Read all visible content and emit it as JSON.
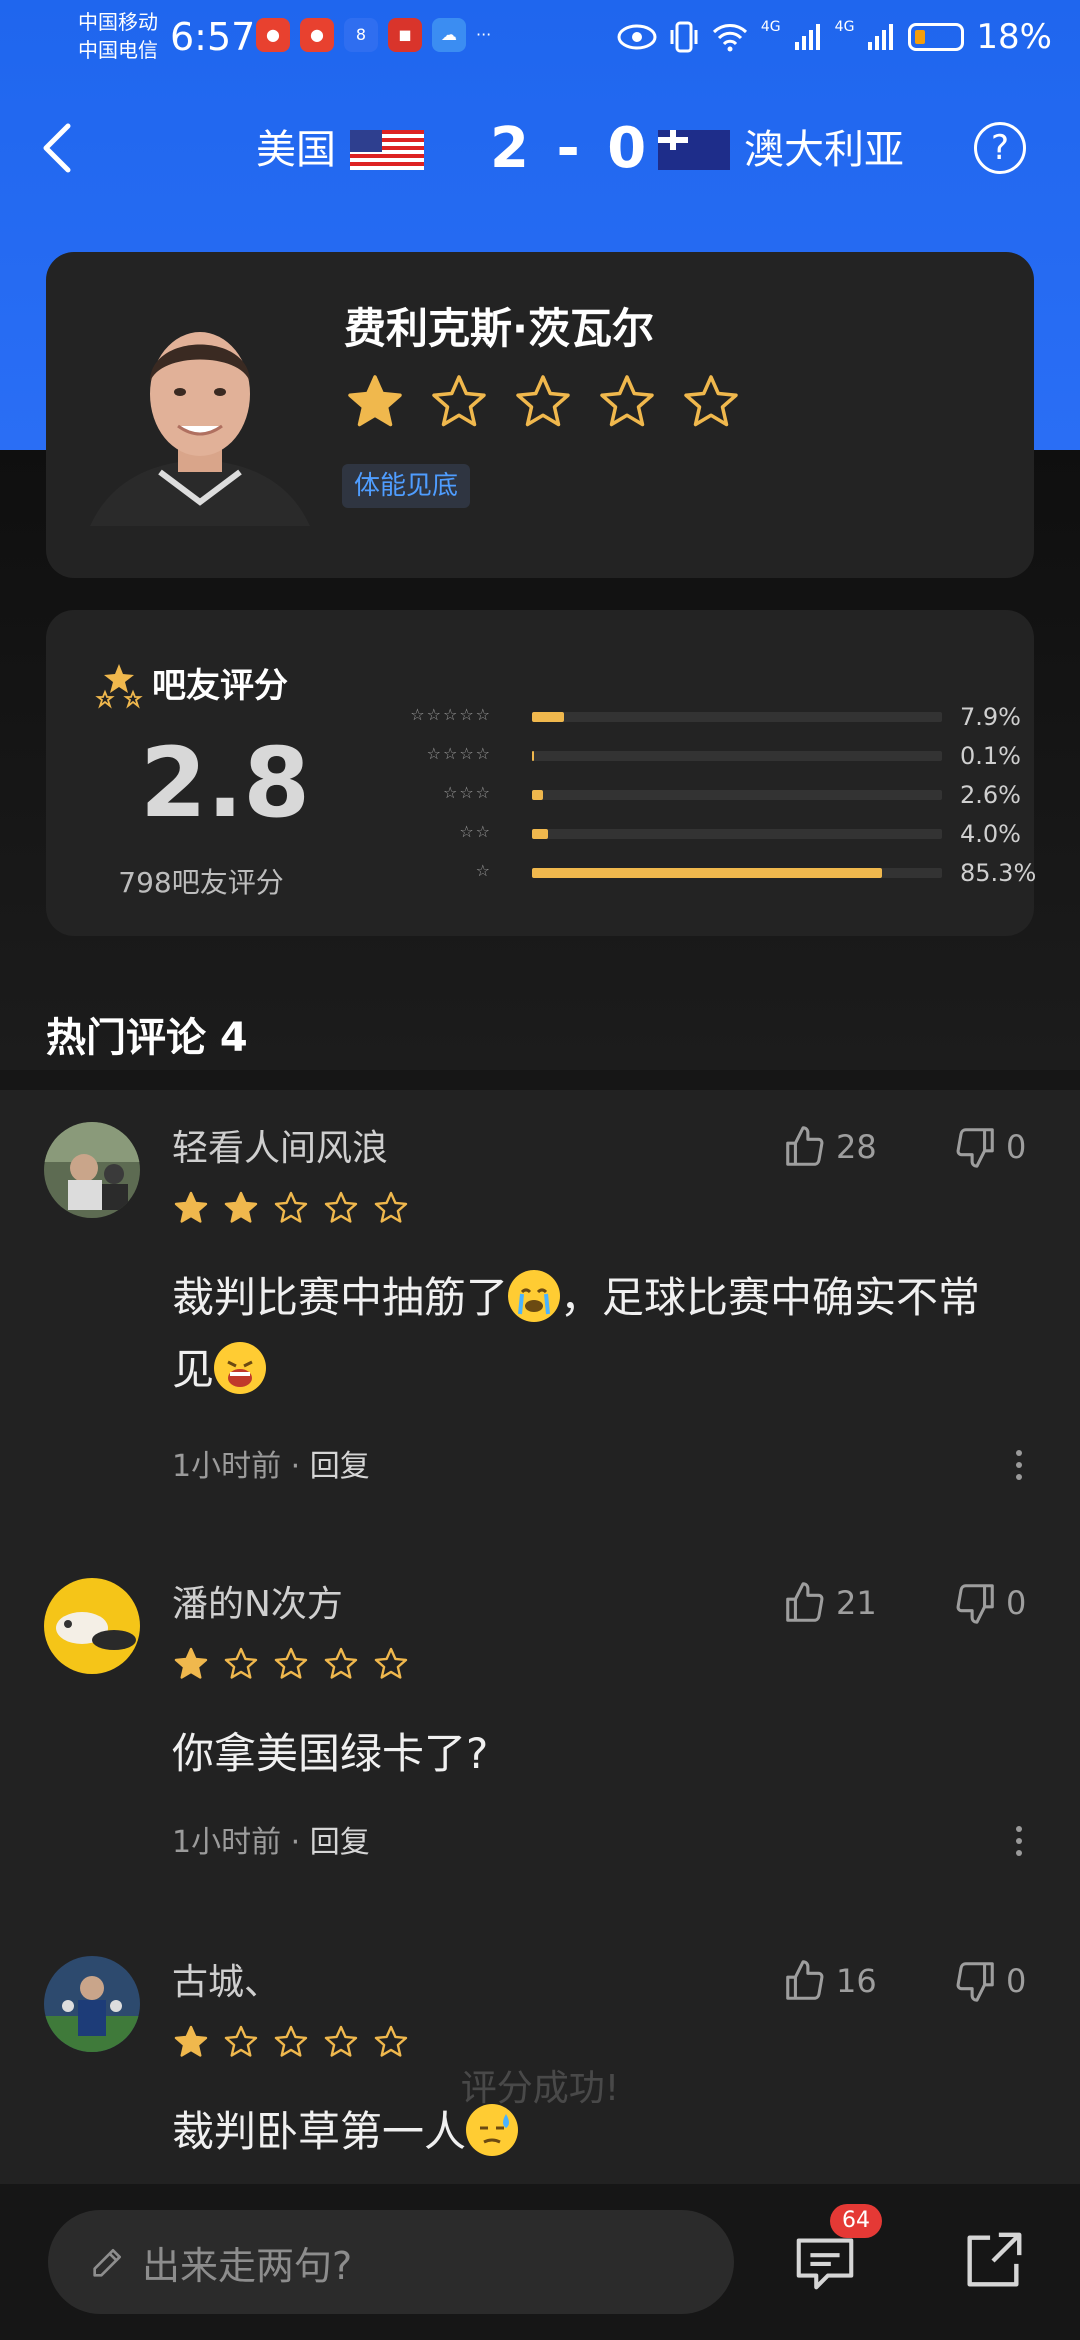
{
  "status_bar": {
    "carrier_1": "中国移动",
    "carrier_2": "中国电信",
    "time": "6:57",
    "network_1": "4G",
    "network_2": "4G",
    "battery": "18%",
    "more": "···"
  },
  "header": {
    "team_home": "美国",
    "score": "2 - 0",
    "team_away": "澳大利亚",
    "help": "?"
  },
  "player": {
    "name": "费利克斯·茨瓦尔",
    "rating_stars": 1,
    "tag": "体能见底"
  },
  "fan_rating": {
    "title": "吧友评分",
    "score": "2.8",
    "count_text": "798吧友评分",
    "distribution": [
      {
        "stars": "☆☆☆☆☆",
        "percent_label": "7.9%",
        "value": 7.9
      },
      {
        "stars": "☆☆☆☆",
        "percent_label": "0.1%",
        "value": 0.1
      },
      {
        "stars": "☆☆☆",
        "percent_label": "2.6%",
        "value": 2.6
      },
      {
        "stars": "☆☆",
        "percent_label": "4.0%",
        "value": 4.0
      },
      {
        "stars": "☆",
        "percent_label": "85.3%",
        "value": 85.3
      }
    ]
  },
  "comments_section": {
    "title": "热门评论 4"
  },
  "comments": [
    {
      "user": "轻看人间风浪",
      "stars": 2,
      "text_1": "裁判比赛中抽筋了",
      "text_2": "，足球比赛中确实不常见",
      "time": "1小时前",
      "reply": "回复",
      "likes": "28",
      "dislikes": "0"
    },
    {
      "user": "潘的N次方",
      "stars": 1,
      "text_1": "你拿美国绿卡了?",
      "time": "1小时前",
      "reply": "回复",
      "likes": "21",
      "dislikes": "0"
    },
    {
      "user": "古城、",
      "stars": 1,
      "text_1": "裁判卧草第一人",
      "likes": "16",
      "dislikes": "0"
    }
  ],
  "toast": "评分成功!",
  "bottom_bar": {
    "input_placeholder": "出来走两句?",
    "comment_badge": "64"
  },
  "colors": {
    "header_blue": "#1f66ee",
    "star_gold": "#f0b84d",
    "tag_blue": "#4f9dff",
    "badge_red": "#e53935"
  }
}
